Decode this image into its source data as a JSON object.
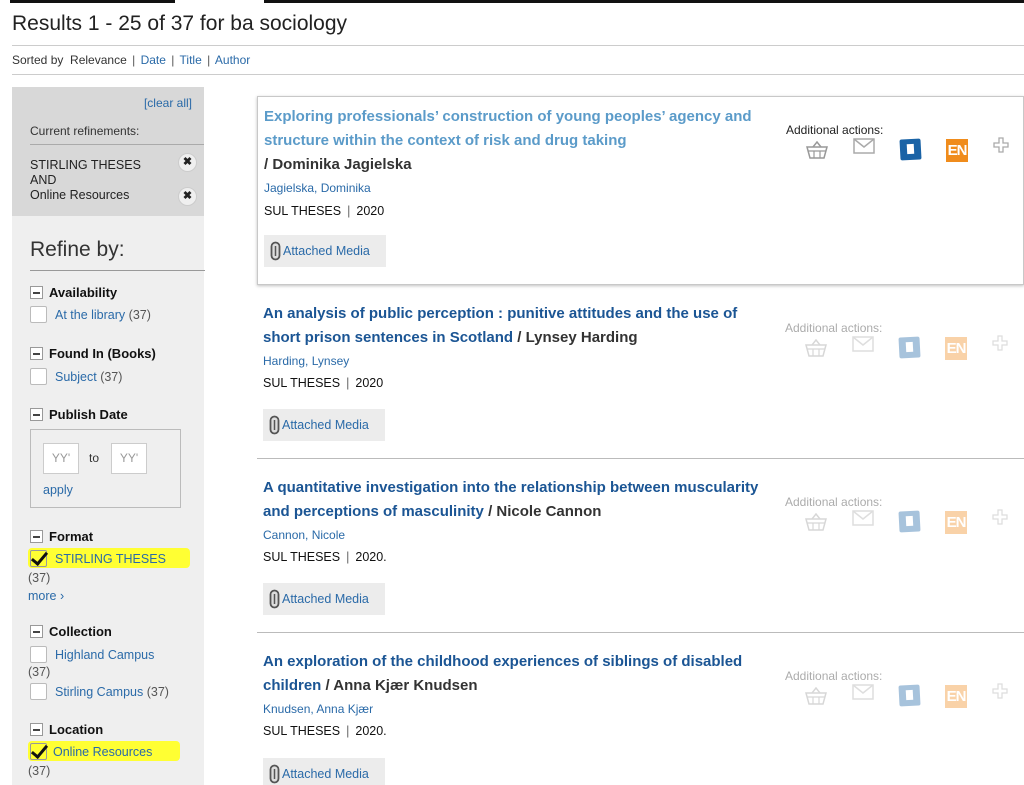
{
  "header": {
    "results_title": "Results 1 - 25 of 37 for ba sociology",
    "sort_prefix": "Sorted by",
    "sort_current": "Relevance",
    "sort_links": [
      "Date",
      "Title",
      "Author"
    ],
    "sort_sep": "|"
  },
  "sidebar": {
    "clear_all": "[clear all]",
    "current_refinements_label": "Current refinements:",
    "refinements": [
      "STIRLING THESES",
      "AND",
      "Online Resources"
    ],
    "remove_icon": "✖",
    "refine_by": "Refine by:",
    "facets": {
      "availability": {
        "title": "Availability",
        "items": [
          {
            "label": "At the library",
            "count": "(37)",
            "checked": false
          }
        ]
      },
      "found_in": {
        "title": "Found In (Books)",
        "items": [
          {
            "label": "Subject",
            "count": "(37)",
            "checked": false
          }
        ]
      },
      "publish_date": {
        "title": "Publish Date",
        "from_placeholder": "YY'",
        "to_label": "to",
        "to_placeholder": "YY'",
        "apply": "apply"
      },
      "format": {
        "title": "Format",
        "items": [
          {
            "label": "STIRLING THESES",
            "count": "(37)",
            "checked": true
          }
        ],
        "more": "more ›"
      },
      "collection": {
        "title": "Collection",
        "items": [
          {
            "label": "Highland Campus",
            "count": "(37)",
            "checked": false
          },
          {
            "label": "Stirling Campus",
            "count": "(37)",
            "checked": false
          }
        ]
      },
      "location": {
        "title": "Location",
        "items": [
          {
            "label": "Online Resources",
            "count": "(37)",
            "checked": true
          }
        ]
      }
    },
    "highlight_color": "#ffff33"
  },
  "results": [
    {
      "title": "Exploring professionals’ construction of young peoples’ agency and structure within the context of risk and drug taking",
      "author_suffix": "/ Dominika Jagielska",
      "author_link": "Jagielska, Dominika",
      "collection": "SUL THESES",
      "year": "2020",
      "media": "Attached Media",
      "actions_label": "Additional actions:",
      "active": true
    },
    {
      "title": "An analysis of public perception : punitive attitudes and the use of short prison sentences in Scotland",
      "author_suffix": "/ Lynsey Harding",
      "author_link": "Harding, Lynsey",
      "collection": "SUL THESES",
      "year": "2020",
      "media": "Attached Media",
      "actions_label": "Additional actions:",
      "active": false
    },
    {
      "title": "A quantitative investigation into the relationship between muscularity and perceptions of masculinity",
      "author_suffix": "/ Nicole Cannon",
      "author_link": "Cannon, Nicole",
      "collection": "SUL THESES",
      "year": "2020.",
      "media": "Attached Media",
      "actions_label": "Additional actions:",
      "active": false
    },
    {
      "title": "An exploration of the childhood experiences of siblings of disabled children",
      "author_suffix": "/ Anna Kjær Knudsen",
      "author_link": "Knudsen, Anna Kjær",
      "collection": "SUL THESES",
      "year": "2020.",
      "media": "Attached Media",
      "actions_label": "Additional actions:",
      "active": false
    }
  ],
  "action_icons": {
    "basket": "basket-icon",
    "email": "email-icon",
    "document": "document-icon",
    "endnote": "EN",
    "add": "plus-icon"
  },
  "colors": {
    "link": "#2a6aa8",
    "title_link": "#1b5594",
    "active_title": "#5b9bc9",
    "endnote_orange": "#f08c1c",
    "doc_blue": "#1a63a6"
  }
}
